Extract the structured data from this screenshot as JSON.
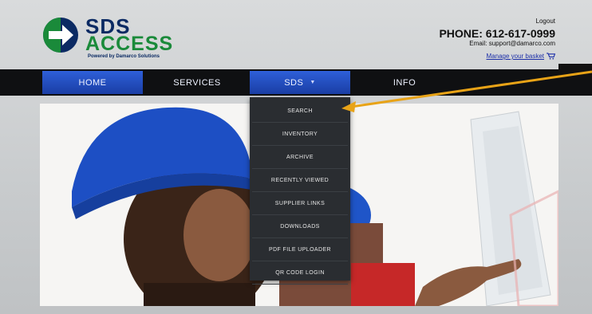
{
  "header": {
    "logo": {
      "line1": "SDS",
      "line2": "ACCESS",
      "tagline": "Powered by Damarco Solutions"
    },
    "logout": "Logout",
    "phone": "PHONE: 612-617-0999",
    "email": "Email:  support@damarco.com",
    "basket": "Manage your basket"
  },
  "nav": {
    "items": [
      {
        "label": "HOME"
      },
      {
        "label": "SERVICES"
      },
      {
        "label": "SDS",
        "caret": "▼"
      },
      {
        "label": "INFO"
      }
    ]
  },
  "dropdown": {
    "items": [
      {
        "label": "SEARCH"
      },
      {
        "label": "INVENTORY"
      },
      {
        "label": "ARCHIVE"
      },
      {
        "label": "RECENTLY VIEWED"
      },
      {
        "label": "SUPPLIER LINKS"
      },
      {
        "label": "DOWNLOADS"
      },
      {
        "label": "PDF FILE UPLOADER"
      },
      {
        "label": "QR CODE LOGIN"
      }
    ]
  },
  "colors": {
    "brand_navy": "#0b2a63",
    "brand_green": "#1a8a3a",
    "nav_active": "#2e5fd8",
    "annotation_arrow": "#e8a317"
  }
}
